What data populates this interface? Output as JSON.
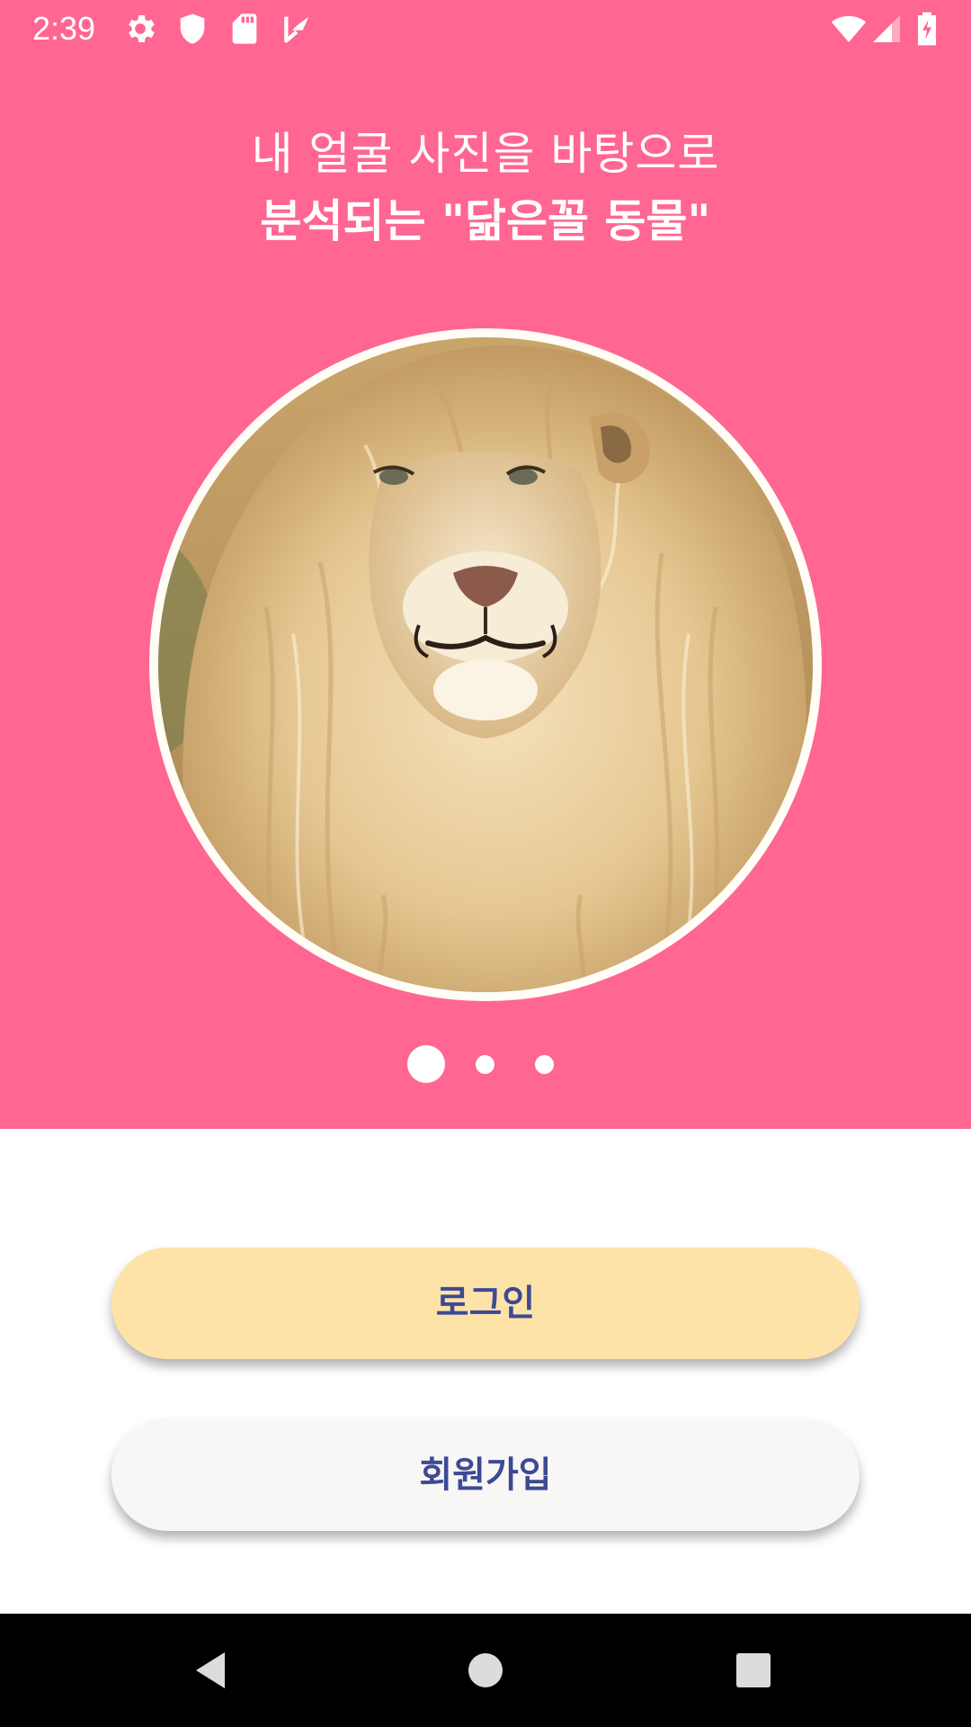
{
  "status_bar": {
    "time": "2:39",
    "icons_left": [
      "gear-icon",
      "shield-icon",
      "sd-card-icon",
      "play-store-icon"
    ],
    "icons_right": [
      "wifi-icon",
      "cell-signal-icon",
      "battery-charging-icon"
    ]
  },
  "hero": {
    "background_color": "#ff6691",
    "headline_line1": "내 얼굴 사진을 바탕으로",
    "headline_line2": "분석되는 \"닮은꼴 동물\"",
    "photo_icon": "lion-photo",
    "page_indicator": {
      "count": 3,
      "active_index": 0
    }
  },
  "buttons": {
    "login_label": "로그인",
    "signup_label": "회원가입",
    "login_color": "#fde3a7",
    "signup_color": "#f8f7f5",
    "text_color": "#3d4a94"
  },
  "nav_bar": {
    "icons": [
      "back-icon",
      "home-icon",
      "recents-icon"
    ]
  }
}
